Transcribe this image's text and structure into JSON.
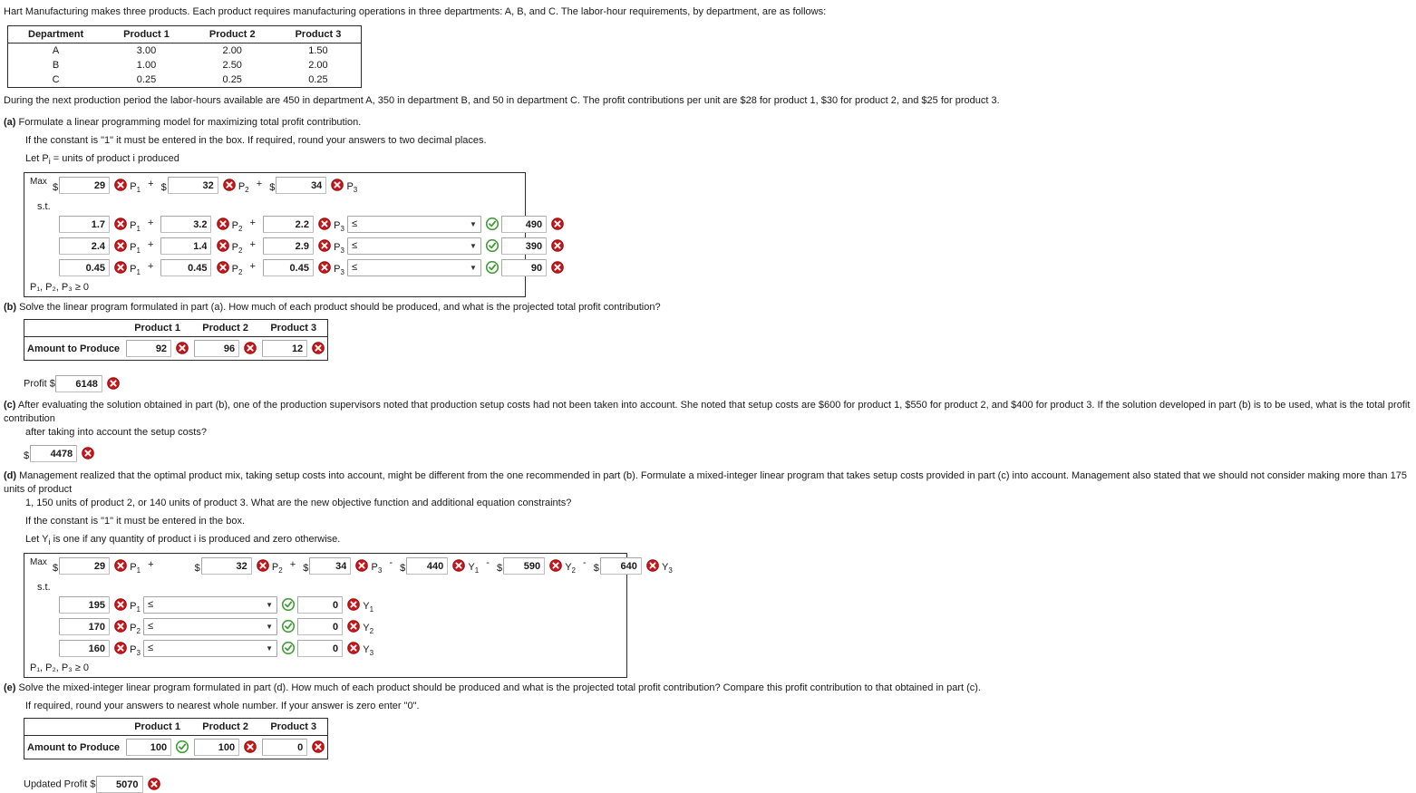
{
  "intro": "Hart Manufacturing makes three products. Each product requires manufacturing operations in three departments: A, B, and C. The labor-hour requirements, by department, are as follows:",
  "labor_table": {
    "headers": [
      "Department",
      "Product 1",
      "Product 2",
      "Product 3"
    ],
    "rows": [
      [
        "A",
        "3.00",
        "2.00",
        "1.50"
      ],
      [
        "B",
        "1.00",
        "2.50",
        "2.00"
      ],
      [
        "C",
        "0.25",
        "0.25",
        "0.25"
      ]
    ]
  },
  "availability": "During the next production period the labor-hours available are 450 in department A, 350 in department B, and 50 in department C. The profit contributions per unit are $28 for product 1, $30 for product 2, and $25 for product 3.",
  "part_a": {
    "marker": "(a)",
    "prompt": "Formulate a linear programming model for maximizing total profit contribution.",
    "note1": "If the constant is \"1\" it must be entered in the box. If required, round your answers to two decimal places.",
    "note2": "Let Pᵢ = units of product i produced",
    "max_label": "Max",
    "st_label": "s.t.",
    "objective": [
      {
        "dollar": "$",
        "value": "29",
        "status": "incorrect",
        "var": "P",
        "sub": "1",
        "op": "+"
      },
      {
        "dollar": "$",
        "value": "32",
        "status": "incorrect",
        "var": "P",
        "sub": "2",
        "op": "+"
      },
      {
        "dollar": "$",
        "value": "34",
        "status": "incorrect",
        "var": "P",
        "sub": "3",
        "op": ""
      }
    ],
    "constraints": [
      {
        "terms": [
          {
            "value": "1.7",
            "status": "incorrect",
            "var": "P",
            "sub": "1",
            "op": "+"
          },
          {
            "value": "3.2",
            "status": "incorrect",
            "var": "P",
            "sub": "2",
            "op": "+"
          },
          {
            "value": "2.2",
            "status": "incorrect",
            "var": "P",
            "sub": "3",
            "op": ""
          }
        ],
        "relation": "≤",
        "relation_status": "correct",
        "rhs": "490",
        "rhs_status": "incorrect"
      },
      {
        "terms": [
          {
            "value": "2.4",
            "status": "incorrect",
            "var": "P",
            "sub": "1",
            "op": "+"
          },
          {
            "value": "1.4",
            "status": "incorrect",
            "var": "P",
            "sub": "2",
            "op": "+"
          },
          {
            "value": "2.9",
            "status": "incorrect",
            "var": "P",
            "sub": "3",
            "op": ""
          }
        ],
        "relation": "≤",
        "relation_status": "correct",
        "rhs": "390",
        "rhs_status": "incorrect"
      },
      {
        "terms": [
          {
            "value": "0.45",
            "status": "incorrect",
            "var": "P",
            "sub": "1",
            "op": "+"
          },
          {
            "value": "0.45",
            "status": "incorrect",
            "var": "P",
            "sub": "2",
            "op": "+"
          },
          {
            "value": "0.45",
            "status": "incorrect",
            "var": "P",
            "sub": "3",
            "op": ""
          }
        ],
        "relation": "≤",
        "relation_status": "correct",
        "rhs": "90",
        "rhs_status": "incorrect"
      }
    ],
    "nonnegativity": "P₁, P₂, P₃ ≥ 0"
  },
  "part_b": {
    "marker": "(b)",
    "prompt": "Solve the linear program formulated in part (a). How much of each product should be produced, and what is the projected total profit contribution?",
    "table": {
      "headers": [
        "",
        "Product 1",
        "Product 2",
        "Product 3"
      ],
      "row_label": "Amount to Produce",
      "values": [
        "92",
        "96",
        "12"
      ],
      "statuses": [
        "incorrect",
        "incorrect",
        "incorrect"
      ]
    },
    "profit_label": "Profit $",
    "profit_value": "6148",
    "profit_status": "incorrect"
  },
  "part_c": {
    "marker": "(c)",
    "prompt_line1": "After evaluating the solution obtained in part (b), one of the production supervisors noted that production setup costs had not been taken into account. She noted that setup costs are $600 for product 1, $550 for product 2, and $400 for product 3. If the solution developed in part (b) is to be used, what is the total profit contribution",
    "prompt_line2": "after taking into account the setup costs?",
    "dollar": "$",
    "value": "4478",
    "status": "incorrect"
  },
  "part_d": {
    "marker": "(d)",
    "prompt_line1": "Management realized that the optimal product mix, taking setup costs into account, might be different from the one recommended in part (b). Formulate a mixed-integer linear program that takes setup costs provided in part (c) into account. Management also stated that we should not consider making more than 175 units of product",
    "prompt_line2": "1, 150 units of product 2, or 140 units of product 3. What are the new objective function and additional equation constraints?",
    "note1": "If the constant is \"1\" it must be entered in the box.",
    "note2": "Let Yᵢ is one if any quantity of product i is produced and zero otherwise.",
    "max_label": "Max",
    "st_label": "s.t.",
    "objective": [
      {
        "dollar": "$",
        "value": "29",
        "status": "incorrect",
        "var": "P",
        "sub": "1",
        "op": "+"
      },
      {
        "dollar": "$",
        "value": "32",
        "status": "incorrect",
        "var": "P",
        "sub": "2",
        "op": "+"
      },
      {
        "dollar": "$",
        "value": "34",
        "status": "incorrect",
        "var": "P",
        "sub": "3",
        "op": "-"
      },
      {
        "dollar": "$",
        "value": "440",
        "status": "incorrect",
        "var": "Y",
        "sub": "1",
        "op": "-"
      },
      {
        "dollar": "$",
        "value": "590",
        "status": "incorrect",
        "var": "Y",
        "sub": "2",
        "op": "-"
      },
      {
        "dollar": "$",
        "value": "640",
        "status": "incorrect",
        "var": "Y",
        "sub": "3",
        "op": ""
      }
    ],
    "constraints": [
      {
        "coef": "195",
        "coef_status": "incorrect",
        "var": "P",
        "sub": "1",
        "relation": "≤",
        "relation_status": "correct",
        "rhs": "0",
        "rhs_status": "incorrect",
        "rhs_var": "Y",
        "rhs_sub": "1"
      },
      {
        "coef": "170",
        "coef_status": "incorrect",
        "var": "P",
        "sub": "2",
        "relation": "≤",
        "relation_status": "correct",
        "rhs": "0",
        "rhs_status": "incorrect",
        "rhs_var": "Y",
        "rhs_sub": "2"
      },
      {
        "coef": "160",
        "coef_status": "incorrect",
        "var": "P",
        "sub": "3",
        "relation": "≤",
        "relation_status": "correct",
        "rhs": "0",
        "rhs_status": "incorrect",
        "rhs_var": "Y",
        "rhs_sub": "3"
      }
    ],
    "nonnegativity": "P₁, P₂, P₃ ≥ 0"
  },
  "part_e": {
    "marker": "(e)",
    "prompt": "Solve the mixed-integer linear program formulated in part (d). How much of each product should be produced and what is the projected total profit contribution? Compare this profit contribution to that obtained in part (c).",
    "note": "If required, round your answers to nearest whole number. If your answer is zero enter \"0\".",
    "table": {
      "headers": [
        "",
        "Product 1",
        "Product 2",
        "Product 3"
      ],
      "row_label": "Amount to Produce",
      "values": [
        "100",
        "100",
        "0"
      ],
      "statuses": [
        "correct",
        "incorrect",
        "incorrect"
      ]
    },
    "profit_label": "Updated Profit $",
    "profit_value": "5070",
    "profit_status": "incorrect"
  },
  "colors": {
    "incorrect": "#c8161a",
    "correct": "#3f9c35",
    "text": "#1a1a1a",
    "border": "#2b2b2b"
  }
}
